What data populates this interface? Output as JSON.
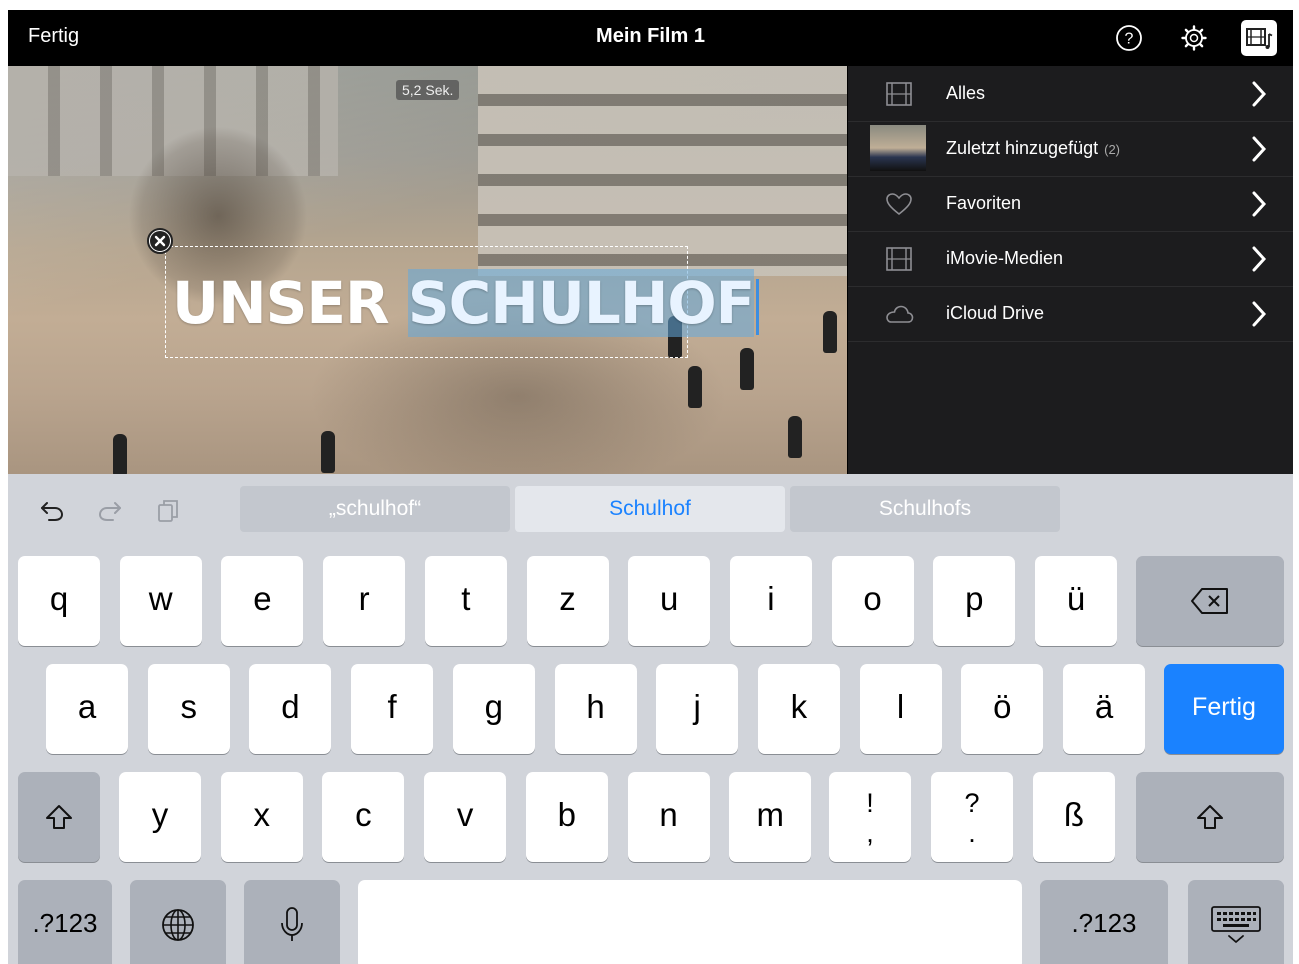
{
  "topbar": {
    "done_label": "Fertig",
    "title": "Mein Film 1",
    "icons": [
      "help-icon",
      "settings-gear-icon",
      "media-film-music-icon"
    ]
  },
  "preview": {
    "duration": "5,2 Sek.",
    "title_plain": "UNSER ",
    "title_selected": "SCHULHOF",
    "title_color": "#ffffff",
    "selection_color": "#64aadc"
  },
  "browser": {
    "items": [
      {
        "label": "Alles",
        "icon": "film-icon",
        "count": ""
      },
      {
        "label": "Zuletzt hinzugefügt",
        "icon": "thumbnail",
        "count": "(2)"
      },
      {
        "label": "Favoriten",
        "icon": "heart-icon",
        "count": ""
      },
      {
        "label": "iMovie-Medien",
        "icon": "film-icon",
        "count": ""
      },
      {
        "label": "iCloud Drive",
        "icon": "cloud-icon",
        "count": ""
      }
    ]
  },
  "keyboard": {
    "suggestions": [
      "„schulhof“",
      "Schulhof",
      "Schulhofs"
    ],
    "row1": [
      "q",
      "w",
      "e",
      "r",
      "t",
      "z",
      "u",
      "i",
      "o",
      "p",
      "ü"
    ],
    "row2": [
      "a",
      "s",
      "d",
      "f",
      "g",
      "h",
      "j",
      "k",
      "l",
      "ö",
      "ä"
    ],
    "row3": [
      "y",
      "x",
      "c",
      "v",
      "b",
      "n",
      "m"
    ],
    "punct1": {
      "top": "!",
      "bottom": ","
    },
    "punct2": {
      "top": "?",
      "bottom": "."
    },
    "eszett": "ß",
    "return_label": "Fertig",
    "numbers_label": ".?123",
    "accent_color": "#1a82ff"
  }
}
